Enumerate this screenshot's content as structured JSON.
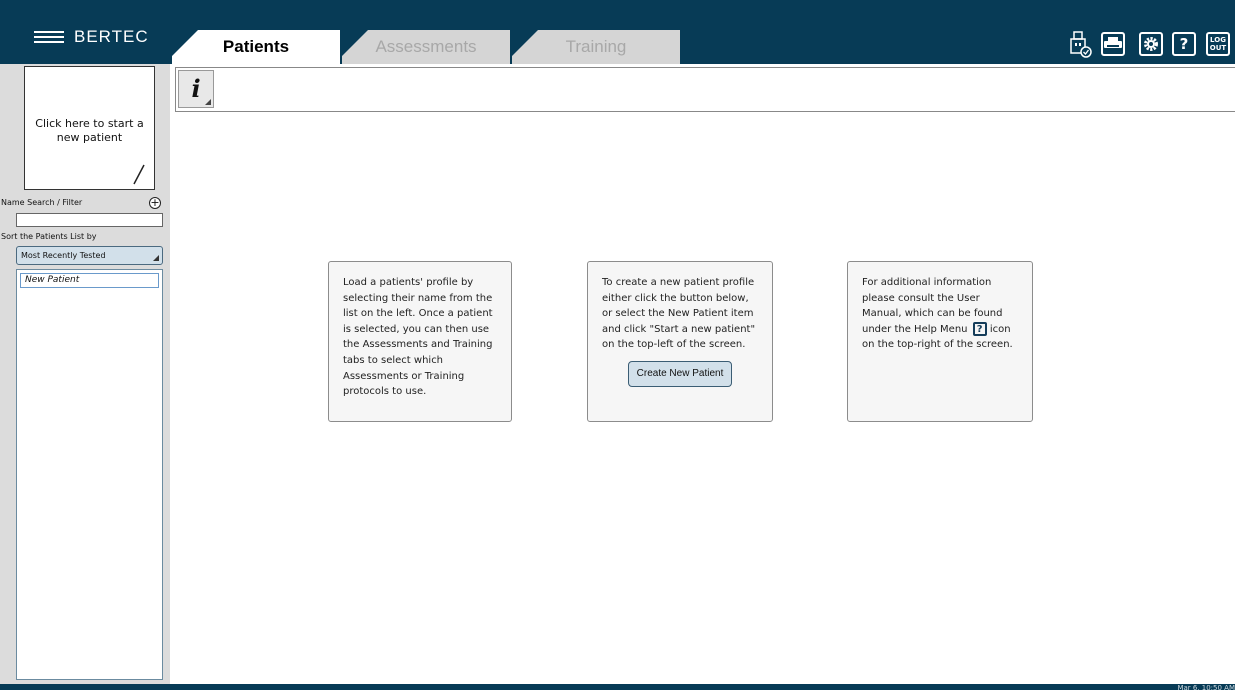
{
  "app": {
    "brand": "BERTEC"
  },
  "tabs": {
    "patients": "Patients",
    "assessments": "Assessments",
    "training": "Training"
  },
  "toolbar": {
    "help_glyph": "?",
    "logout_line1": "LOG",
    "logout_line2": "OUT"
  },
  "sidebar": {
    "new_patient_prompt": "Click here to start a new patient",
    "search_label": "Name Search / Filter",
    "search_value": "",
    "sort_label": "Sort the Patients List by",
    "sort_selected": "Most Recently Tested",
    "patients": [
      "New Patient"
    ]
  },
  "main": {
    "info_glyph": "i",
    "card1_text": "Load a patients' profile by selecting their name from the list on the left. Once a patient is selected, you can then use the Assessments and Training tabs to select which Assessments or Training protocols to use.",
    "card2_text": "To create a new patient profile either click the button below, or select the New Patient item and click \"Start a new patient\" on the top-left of the screen.",
    "create_button": "Create New Patient",
    "card3_text_before": "For additional information please consult the User Manual, which can be found under the Help Menu",
    "card3_help_glyph": "?",
    "card3_text_after": "icon on the top-right of the screen."
  },
  "status": {
    "timestamp": "Mar 6, 10:50 AM"
  },
  "colors": {
    "header_bg": "#073b56",
    "sidebar_bg": "#dcdcdc",
    "button_bg": "#d2e0ea"
  }
}
